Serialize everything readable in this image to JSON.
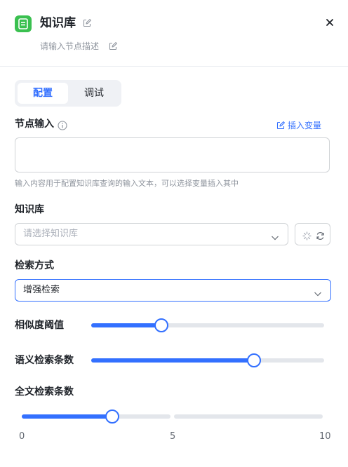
{
  "header": {
    "title": "知识库",
    "description_placeholder": "请输入节点描述",
    "accent_color": "#3ac050"
  },
  "tabs": [
    {
      "label": "配置",
      "active": true
    },
    {
      "label": "调试",
      "active": false
    }
  ],
  "node_input": {
    "label": "节点输入",
    "insert_variable": "插入变量",
    "value": "",
    "hint": "输入内容用于配置知识库查询的输入文本，可以选择变量插入其中"
  },
  "knowledge_base": {
    "label": "知识库",
    "placeholder": "请选择知识库"
  },
  "search_method": {
    "label": "检索方式",
    "value": "增强检索"
  },
  "similarity": {
    "label": "相似度阈值",
    "level_percent": 30
  },
  "semantic_count": {
    "label": "语义检索条数",
    "level_percent": 70
  },
  "fulltext_count": {
    "label": "全文检索条数",
    "value": 3,
    "min": 0,
    "max": 10,
    "ticks": [
      "0",
      "5",
      "10"
    ]
  },
  "colors": {
    "primary": "#3370ff",
    "track": "#e3e6eb"
  }
}
